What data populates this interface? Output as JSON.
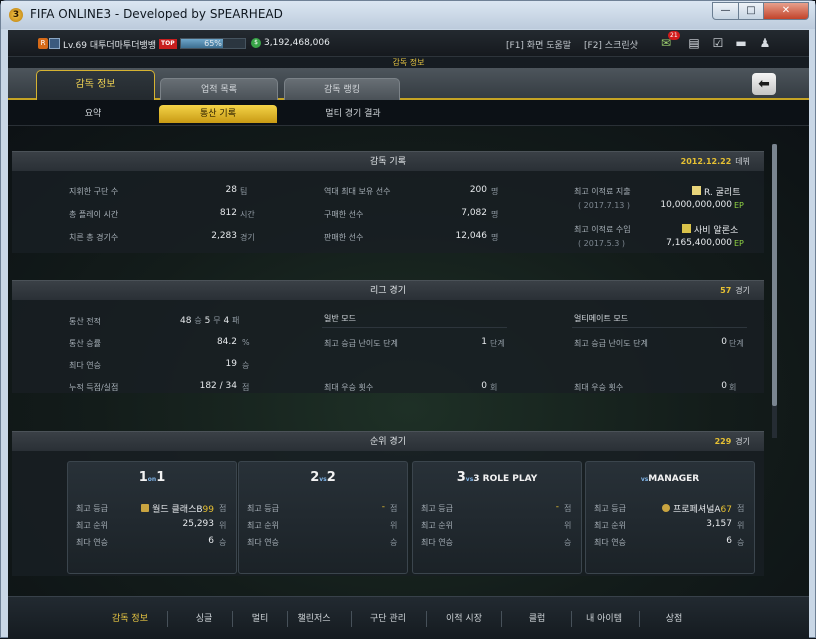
{
  "window": {
    "title": "FIFA ONLINE3 - Developed by SPEARHEAD",
    "min": "—",
    "max": "□",
    "close": "✕"
  },
  "topbar": {
    "level_badge": "R",
    "level_text": "Lv.69 대투더마투더뱅뱅",
    "top_tag": "TOP",
    "exp_percent": 65,
    "exp_label": "65%",
    "coin": "$",
    "money": "3,192,468,006",
    "help_f1": "[F1] 화면 도움말",
    "help_f2": "[F2] 스크린샷",
    "mail_count": "21"
  },
  "screen_title": "감독 정보",
  "tabs": {
    "manager": "감독 정보",
    "achievements": "업적 목록",
    "ranking": "감독 랭킹"
  },
  "subtabs": {
    "summary": "요약",
    "career": "통산 기록",
    "multi": "멀티 경기 결과"
  },
  "record": {
    "title": "감독 기록",
    "debut_date": "2012.12.22",
    "debut_label": "데뷔",
    "teams": {
      "label": "지휘한 구단 수",
      "value": "28",
      "unit": "팀"
    },
    "playtime": {
      "label": "총 플레이 시간",
      "value": "812",
      "unit": "시간"
    },
    "games": {
      "label": "치른 총 경기수",
      "value": "2,283",
      "unit": "경기"
    },
    "max_players": {
      "label": "역대 최대 보유 선수",
      "value": "200",
      "unit": "명"
    },
    "bought": {
      "label": "구매한 선수",
      "value": "7,082",
      "unit": "명"
    },
    "sold": {
      "label": "판매한 선수",
      "value": "12,046",
      "unit": "명"
    },
    "max_spend": {
      "label": "최고 이적료 지출",
      "date": "( 2017.7.13 )",
      "player": "R. 굴리트",
      "amount": "10,000,000,000",
      "unit": "EP"
    },
    "max_income": {
      "label": "최고 이적료 수입",
      "date": "( 2017.5.3 )",
      "player": "사비 알론소",
      "amount": "7,165,400,000",
      "unit": "EP"
    }
  },
  "league": {
    "title": "리그 경기",
    "count": "57",
    "count_unit": "경기",
    "record": {
      "label": "통산 전적",
      "w": "48",
      "w_unit": "승",
      "d": "5",
      "d_unit": "무",
      "l": "4",
      "l_unit": "패"
    },
    "winrate": {
      "label": "통산 승률",
      "value": "84.2",
      "unit": "%"
    },
    "streak": {
      "label": "최다 연승",
      "value": "19",
      "unit": "승"
    },
    "goals": {
      "label": "누적 득점/실점",
      "value": "182 / 34",
      "unit": "점"
    },
    "normal": {
      "title": "일반 모드",
      "diff_label": "최고 승급 난이도 단계",
      "diff_value": "1",
      "diff_unit": "단계",
      "win_label": "최대 우승 횟수",
      "win_value": "0",
      "win_unit": "회"
    },
    "ultimate": {
      "title": "얼티메이트 모드",
      "diff_label": "최고 승급 난이도 단계",
      "diff_value": "0",
      "diff_unit": "단계",
      "win_label": "최대 우승 횟수",
      "win_value": "0",
      "win_unit": "회"
    }
  },
  "ranked": {
    "title": "순위 경기",
    "count": "229",
    "count_unit": "경기",
    "labels": {
      "grade": "최고 등급",
      "rank": "최고 순위",
      "streak": "최다 연승",
      "pt": "점",
      "pos": "위",
      "win": "승"
    },
    "cards": [
      {
        "t1": "1",
        "t2": "on",
        "t3": "1",
        "grade_name": "월드 클래스B",
        "grade_pts": "99",
        "rank": "25,293",
        "streak": "6"
      },
      {
        "t1": "2",
        "t2": "vs",
        "t3": "2",
        "grade_name": "",
        "grade_pts": "-",
        "rank": "",
        "streak": ""
      },
      {
        "t1": "3",
        "t2": "vs",
        "t3": "3 ROLE PLAY",
        "grade_name": "",
        "grade_pts": "-",
        "rank": "",
        "streak": ""
      },
      {
        "t1": "",
        "t2": "vs",
        "t3": "MANAGER",
        "grade_name": "프로페셔널A",
        "grade_pts": "67",
        "rank": "3,157",
        "streak": "6"
      }
    ]
  },
  "nav": [
    "감독 정보",
    "싱글",
    "멀티",
    "챌린저스",
    "구단 관리",
    "이적 시장",
    "클럽",
    "내 아이템",
    "상점"
  ]
}
